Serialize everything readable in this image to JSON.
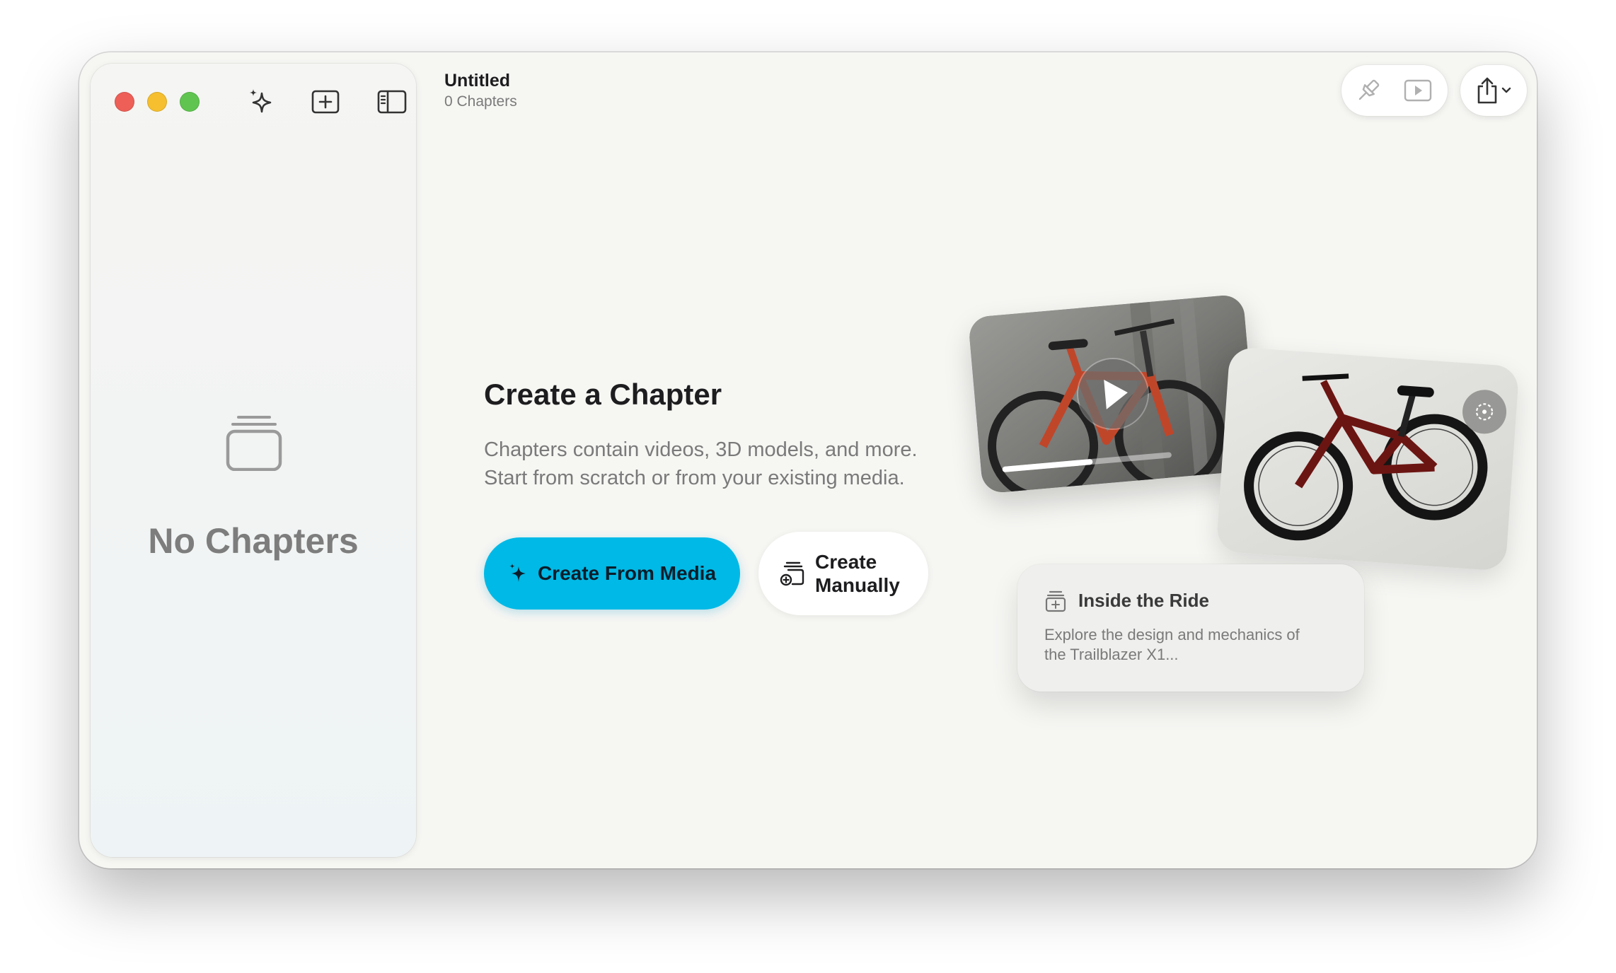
{
  "window": {
    "title": "Untitled",
    "subtitle": "0 Chapters"
  },
  "toolbar": {
    "icons": [
      "sparkles-icon",
      "add-chapter-icon",
      "sidebar-toggle-icon",
      "pin-icon",
      "play-preview-icon",
      "share-icon",
      "chevron-down-icon"
    ]
  },
  "sidebar": {
    "empty_title": "No Chapters",
    "empty_icon": "stack-icon"
  },
  "main": {
    "heading": "Create a Chapter",
    "description_line1": "Chapters contain videos, 3D models, and more.",
    "description_line2": "Start from scratch or from your existing media.",
    "create_from_media_label": "Create From Media",
    "create_manually_label": "Create Manually"
  },
  "preview": {
    "card_title": "Inside the Ride",
    "card_desc_line1": "Explore the design and mechanics of",
    "card_desc_line2": "the Trailblazer X1..."
  },
  "colors": {
    "accent": "#00b9e6",
    "window_bg": "#f6f6f3",
    "close": "#ed5f57",
    "minimize": "#f5bf2f",
    "maximize": "#5fc550"
  }
}
